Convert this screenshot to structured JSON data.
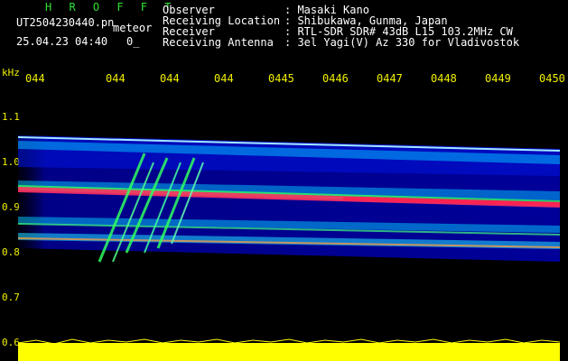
{
  "header": {
    "app_title": "H R O F F T",
    "file_name": "UT2504230440.pn",
    "meteor_label": "meteor",
    "timestamp": "25.04.23 04:40",
    "frame_count": "0_",
    "info": [
      {
        "label": "Observer",
        "value": ": Masaki Kano"
      },
      {
        "label": "Receiving Location",
        "value": ": Shibukawa, Gunma, Japan"
      },
      {
        "label": "Receiver",
        "value": ": RTL-SDR SDR# 43dB L15 103.2MHz CW"
      },
      {
        "label": "Receiving Antenna",
        "value": ": 3el Yagi(V) Az 330 for Vladivostok"
      }
    ]
  },
  "axes": {
    "unit": "kHz",
    "time_ticks": [
      "044",
      "044",
      "044",
      "044",
      "0445",
      "0446",
      "0447",
      "0448",
      "0449",
      "0450"
    ],
    "freq_ticks": [
      "1.1",
      "1.0",
      "0.9",
      "0.8",
      "0.7",
      "0.6"
    ]
  },
  "colors": {
    "background": "#000000",
    "label": "#f0f000",
    "title": "#2fe02f",
    "noise_floor": "#0000c8",
    "signal_low": "#00d0ff",
    "signal_mid": "#30ff60",
    "signal_high": "#ff3060",
    "audio_bar": "#ffff00"
  }
}
